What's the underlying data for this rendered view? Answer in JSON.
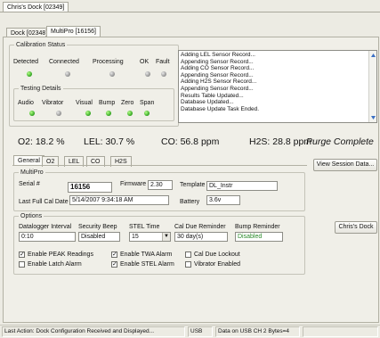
{
  "window_tab": "Chris's Dock [02349]",
  "sub_tabs": [
    "Dock [02348]",
    "MultiPro [16156]"
  ],
  "calibration": {
    "title": "Calibration Status",
    "indicators": [
      {
        "label": "Detected",
        "state": "green"
      },
      {
        "label": "Connected",
        "state": "gray"
      },
      {
        "label": "Processing",
        "state": "gray"
      },
      {
        "label": "OK",
        "state": "gray"
      },
      {
        "label": "Fault",
        "state": "gray"
      }
    ],
    "testing": {
      "title": "Testing Details",
      "indicators": [
        {
          "label": "Audio",
          "state": "green"
        },
        {
          "label": "Vibrator",
          "state": "gray"
        },
        {
          "label": "Visual",
          "state": "green"
        },
        {
          "label": "Bump",
          "state": "green"
        },
        {
          "label": "Zero",
          "state": "green"
        },
        {
          "label": "Span",
          "state": "green"
        }
      ]
    },
    "log": [
      "Adding LEL Sensor Record...",
      "Appending Sensor Record...",
      "Adding CO Sensor Record...",
      "Appending Sensor Record...",
      "Adding H2S Sensor Record...",
      "Appending Sensor Record...",
      "Results Table Updated...",
      "Database Updated...",
      "Database Update Task Ended."
    ]
  },
  "readings": {
    "o2": "O2: 18.2 %",
    "lel": "LEL: 30.7 %",
    "co": "CO: 56.8 ppm",
    "h2s": "H2S: 28.8 ppm",
    "status": "Purge Complete"
  },
  "detail_tabs": [
    "General",
    "O2",
    "LEL",
    "CO",
    "H2S"
  ],
  "multipro": {
    "title": "MultiPro",
    "serial_label": "Serial #",
    "serial": "16156",
    "firmware_label": "Firmware",
    "firmware": "2.30",
    "template_label": "Template",
    "template": "DL_Instr",
    "last_cal_label": "Last Full Cal Date",
    "last_cal": "5/14/2007 9:34:18 AM",
    "battery_label": "Battery",
    "battery": "3.6v"
  },
  "options": {
    "title": "Options",
    "datalogger_label": "Datalogger Interval",
    "datalogger": "0:10",
    "security_label": "Security Beep",
    "security": "Disabled",
    "stel_label": "STEL Time",
    "stel": "15",
    "cal_due_label": "Cal Due Reminder",
    "cal_due": "30 day(s)",
    "bump_label": "Bump Reminder",
    "bump": "Disabled",
    "checks": [
      {
        "label": "Enable PEAK Readings",
        "checked": true
      },
      {
        "label": "Enable TWA Alarm",
        "checked": true
      },
      {
        "label": "Cal Due Lockout",
        "checked": false
      },
      {
        "label": "Enable Latch Alarm",
        "checked": false
      },
      {
        "label": "Enable STEL Alarm",
        "checked": true
      },
      {
        "label": "Vibrator Enabled",
        "checked": false
      }
    ]
  },
  "buttons": {
    "view_session": "View Session Data...",
    "dock": "Chris's Dock"
  },
  "statusbar": {
    "last_action": "Last Action: Dock Configuration Received and Displayed...",
    "usb": "USB",
    "data": "Data on USB CH 2 Bytes=4"
  },
  "colors": {
    "led_green": "#2ea21d",
    "led_gray": "#8f8f8f",
    "bump_text": "#2a8a2a"
  }
}
